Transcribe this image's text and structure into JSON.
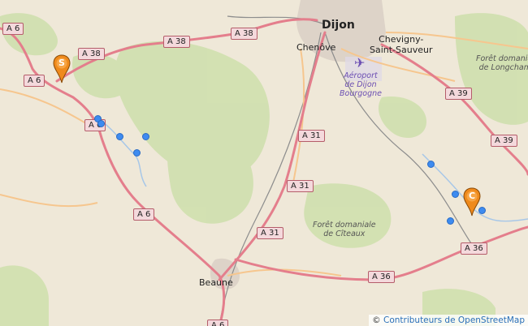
{
  "map": {
    "cities": {
      "dijon": "Dijon",
      "chenove": "Chenôve",
      "chevigny": "Chevigny-\nSaint-Sauveur",
      "beaune": "Beaune"
    },
    "airport": "Aéroport\nde Dijon\nBourgogne",
    "forests": {
      "longchamp": "Forêt domaniale\nde Longchamp",
      "citeaux": "Forêt domaniale\nde Cîteaux"
    },
    "roads": {
      "a6_tl": "A 6",
      "a6_l": "A 6",
      "a38_a": "A 38",
      "a38_b": "A 38",
      "a38_c": "A 38",
      "a6_mid": "A 6",
      "a6_s": "A 6",
      "a6_bottom": "A 6",
      "a31_a": "A 31",
      "a31_b": "A 31",
      "a31_c": "A 31",
      "a39_a": "A 39",
      "a39_b": "A 39",
      "a36_a": "A 36",
      "a36_b": "A 36"
    },
    "markers": {
      "start": "S",
      "end": "C"
    },
    "attribution": {
      "symbol": "©",
      "text": "Contributeurs de OpenStreetMap"
    },
    "colors": {
      "background": "#efe8d8",
      "forest": "#cfe0ae",
      "motorway": "#e47e8c",
      "primary": "#f6c68e",
      "marker": "#ef8a1c",
      "dot": "#3d8bf0"
    }
  }
}
